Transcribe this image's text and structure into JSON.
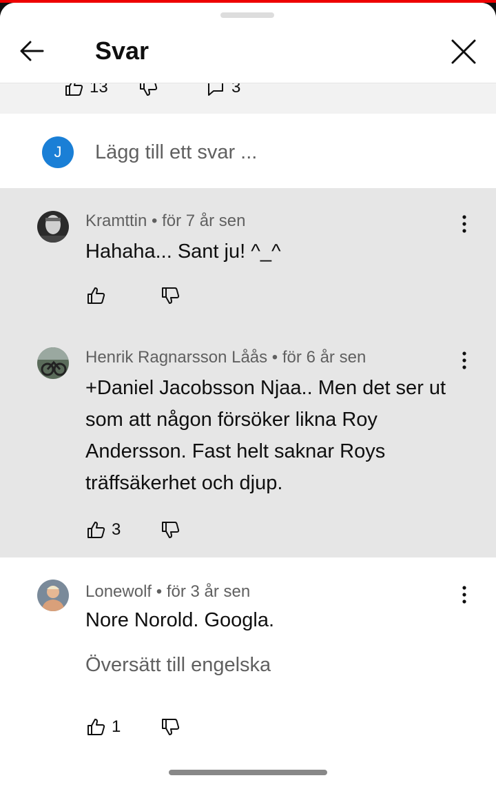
{
  "header": {
    "title": "Svar"
  },
  "peek": {
    "like_count": "13",
    "reply_count": "3"
  },
  "add_reply": {
    "avatar_letter": "J",
    "placeholder": "Lägg till ett svar ..."
  },
  "comments": [
    {
      "author": "Kramttin",
      "time": "för 7 år sen",
      "text": "Hahaha... Sant ju! ^_^",
      "likes": ""
    },
    {
      "author": "Henrik Ragnarsson Låås",
      "time": "för 6 år sen",
      "text": "+Daniel Jacobsson Njaa.. Men det ser ut som att någon försöker likna Roy Andersson. Fast helt saknar Roys träffsäkerhet och djup.",
      "likes": "3"
    },
    {
      "author": "Lonewolf",
      "time": "för 3 år sen",
      "text": "Nore Norold. Googla.",
      "translate": "Översätt till engelska",
      "likes": "1"
    }
  ],
  "separator": " • ",
  "colors": {
    "accent_avatar": "#1a7fd6",
    "highlight_bg": "#e6e6e6"
  }
}
